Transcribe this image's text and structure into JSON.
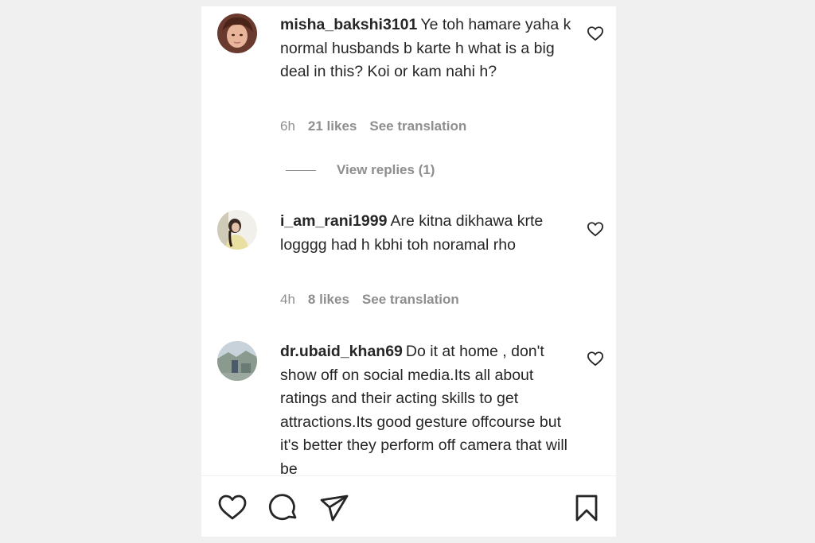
{
  "comments": [
    {
      "username": "misha_bakshi3101",
      "text": "Ye toh hamare yaha k normal husbands b karte h what is a big deal in this? Koi or kam nahi h?",
      "time": "6h",
      "likes": "21 likes",
      "translate": "See translation",
      "view_replies": "View replies (1)"
    },
    {
      "username": "i_am_rani1999",
      "text": "Are kitna dikhawa krte logggg had h kbhi toh noramal rho",
      "time": "4h",
      "likes": "8 likes",
      "translate": "See translation"
    },
    {
      "username": "dr.ubaid_khan69",
      "text": "Do it at home , don't show off on social media.Its all about ratings and their acting skills to get attractions.Its good gesture offcourse but it's better they perform off camera that will be"
    }
  ],
  "icons": {
    "comment_like": "heart-outline-icon",
    "post_like": "heart-outline-icon",
    "comment": "comment-bubble-icon",
    "share": "paper-plane-icon",
    "save": "bookmark-icon"
  }
}
